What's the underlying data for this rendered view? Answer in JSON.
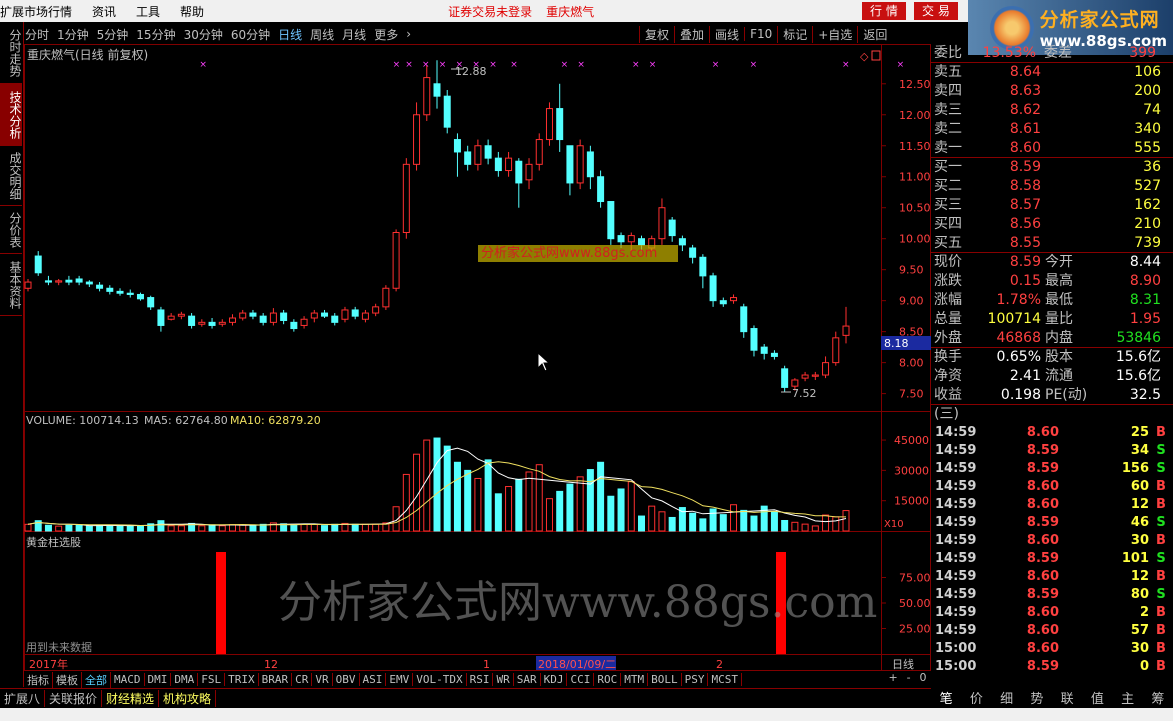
{
  "menubar": {
    "items": [
      "扩展市场行情",
      "资讯",
      "工具",
      "帮助"
    ],
    "status_notice": "证券交易未登录",
    "stock_title": "重庆燃气",
    "right_buttons": [
      "行 情",
      "交 易"
    ],
    "logo_text": "分析家公式网",
    "logo_url": "www.88gs.com"
  },
  "left_tabs": [
    "分时走势",
    "技术分析",
    "成交明细",
    "分价表",
    "基本资料"
  ],
  "period_bar": {
    "items": [
      "分时",
      "1分钟",
      "5分钟",
      "15分钟",
      "30分钟",
      "60分钟",
      "日线",
      "周线",
      "月线",
      "更多"
    ],
    "active": "日线",
    "right_items": [
      "复权",
      "叠加",
      "画线",
      "F10",
      "标记",
      "+自选",
      "返回"
    ]
  },
  "main_chart": {
    "title": "重庆燃气(日线 前复权)",
    "high_label": "12.88",
    "low_label": "7.52",
    "current_price_tag": "8.18",
    "y_ticks": [
      "12.50",
      "12.00",
      "11.50",
      "11.00",
      "10.50",
      "10.00",
      "9.50",
      "9.00",
      "8.50",
      "8.00",
      "7.50"
    ]
  },
  "volume_panel": {
    "header": "VOLUME: 100714.13",
    "ma5": "MA5: 62764.80",
    "ma10": "MA10: 62879.20",
    "y_ticks": [
      "45000",
      "30000",
      "15000"
    ],
    "unit": "X10"
  },
  "gold_panel": {
    "title": "黄金柱选股",
    "note": "用到未来数据",
    "y_ticks": [
      "75.00",
      "50.00",
      "25.00"
    ]
  },
  "time_axis": {
    "labels": [
      "2017年",
      "12",
      "1",
      "2018/01/09/二",
      "2"
    ],
    "period": "日线",
    "controls": [
      "+",
      "-",
      "0"
    ]
  },
  "quote": {
    "weibi_label": "委比",
    "weibi_value": "13.53%",
    "weicha_label": "委差",
    "weicha_value": "399",
    "asks": [
      {
        "label": "卖五",
        "price": "8.64",
        "vol": "106"
      },
      {
        "label": "卖四",
        "price": "8.63",
        "vol": "200"
      },
      {
        "label": "卖三",
        "price": "8.62",
        "vol": "74"
      },
      {
        "label": "卖二",
        "price": "8.61",
        "vol": "340"
      },
      {
        "label": "卖一",
        "price": "8.60",
        "vol": "555"
      }
    ],
    "bids": [
      {
        "label": "买一",
        "price": "8.59",
        "vol": "36"
      },
      {
        "label": "买二",
        "price": "8.58",
        "vol": "527"
      },
      {
        "label": "买三",
        "price": "8.57",
        "vol": "162"
      },
      {
        "label": "买四",
        "price": "8.56",
        "vol": "210"
      },
      {
        "label": "买五",
        "price": "8.55",
        "vol": "739"
      }
    ],
    "stats": [
      {
        "l1": "现价",
        "v1": "8.59",
        "c1": "red",
        "l2": "今开",
        "v2": "8.44",
        "c2": "wht"
      },
      {
        "l1": "涨跌",
        "v1": "0.15",
        "c1": "red",
        "l2": "最高",
        "v2": "8.90",
        "c2": "red"
      },
      {
        "l1": "涨幅",
        "v1": "1.78%",
        "c1": "red",
        "l2": "最低",
        "v2": "8.31",
        "c2": "grn"
      },
      {
        "l1": "总量",
        "v1": "100714",
        "c1": "yel",
        "l2": "量比",
        "v2": "1.95",
        "c2": "red"
      },
      {
        "l1": "外盘",
        "v1": "46868",
        "c1": "red",
        "l2": "内盘",
        "v2": "53846",
        "c2": "grn"
      }
    ],
    "fundamentals": [
      {
        "l1": "换手",
        "v1": "0.65%",
        "l2": "股本",
        "v2": "15.6亿"
      },
      {
        "l1": "净资",
        "v1": "2.41",
        "l2": "流通",
        "v2": "15.6亿"
      },
      {
        "l1": "收益(三)",
        "v1": "0.198",
        "l2": "PE(动)",
        "v2": "32.5"
      }
    ]
  },
  "ticks": [
    {
      "t": "14:59",
      "p": "8.60",
      "v": "25",
      "s": "B"
    },
    {
      "t": "14:59",
      "p": "8.59",
      "v": "34",
      "s": "S"
    },
    {
      "t": "14:59",
      "p": "8.59",
      "v": "156",
      "s": "S"
    },
    {
      "t": "14:59",
      "p": "8.60",
      "v": "60",
      "s": "B"
    },
    {
      "t": "14:59",
      "p": "8.60",
      "v": "12",
      "s": "B"
    },
    {
      "t": "14:59",
      "p": "8.59",
      "v": "46",
      "s": "S"
    },
    {
      "t": "14:59",
      "p": "8.60",
      "v": "30",
      "s": "B"
    },
    {
      "t": "14:59",
      "p": "8.59",
      "v": "101",
      "s": "S"
    },
    {
      "t": "14:59",
      "p": "8.60",
      "v": "12",
      "s": "B"
    },
    {
      "t": "14:59",
      "p": "8.59",
      "v": "80",
      "s": "S"
    },
    {
      "t": "14:59",
      "p": "8.60",
      "v": "2",
      "s": "B"
    },
    {
      "t": "14:59",
      "p": "8.60",
      "v": "57",
      "s": "B"
    },
    {
      "t": "15:00",
      "p": "8.60",
      "v": "30",
      "s": "B"
    },
    {
      "t": "15:00",
      "p": "8.59",
      "v": "0",
      "s": "B"
    }
  ],
  "bottom_tabs": [
    "笔",
    "价",
    "细",
    "势",
    "联",
    "值",
    "主",
    "筹"
  ],
  "indicator_tabs": [
    "指标",
    "模板",
    "全部",
    "MACD",
    "DMI",
    "DMA",
    "FSL",
    "TRIX",
    "BRAR",
    "CR",
    "VR",
    "OBV",
    "ASI",
    "EMV",
    "VOL-TDX",
    "RSI",
    "WR",
    "SAR",
    "KDJ",
    "CCI",
    "ROC",
    "MTM",
    "BOLL",
    "PSY",
    "MCST"
  ],
  "indicator_active": "全部",
  "status_bar": [
    "扩展八",
    "关联报价",
    "财经精选",
    "机构攻略"
  ],
  "watermark_main": "分析家公式网www.88gs.com",
  "watermark_band": "分析家公式网www.88gs.com",
  "colors": {
    "up": "#ff3030",
    "down": "#54ffff",
    "border": "#800000"
  },
  "chart_data": {
    "type": "candlestick",
    "title": "重庆燃气(日线 前复权)",
    "ylim": [
      7.3,
      12.9
    ],
    "candles": [
      [
        9.2,
        9.3,
        9.15,
        9.35
      ],
      [
        9.72,
        9.45,
        9.4,
        9.8
      ],
      [
        9.32,
        9.3,
        9.25,
        9.4
      ],
      [
        9.3,
        9.32,
        9.25,
        9.35
      ],
      [
        9.33,
        9.3,
        9.25,
        9.4
      ],
      [
        9.35,
        9.3,
        9.25,
        9.4
      ],
      [
        9.3,
        9.27,
        9.22,
        9.33
      ],
      [
        9.25,
        9.2,
        9.15,
        9.3
      ],
      [
        9.2,
        9.15,
        9.1,
        9.25
      ],
      [
        9.15,
        9.12,
        9.08,
        9.2
      ],
      [
        9.12,
        9.1,
        9.05,
        9.18
      ],
      [
        9.1,
        9.03,
        9.0,
        9.13
      ],
      [
        9.05,
        8.9,
        8.85,
        9.08
      ],
      [
        8.85,
        8.6,
        8.5,
        8.9
      ],
      [
        8.7,
        8.75,
        8.68,
        8.8
      ],
      [
        8.75,
        8.78,
        8.7,
        8.82
      ],
      [
        8.75,
        8.6,
        8.55,
        8.8
      ],
      [
        8.62,
        8.65,
        8.58,
        8.7
      ],
      [
        8.65,
        8.6,
        8.55,
        8.72
      ],
      [
        8.62,
        8.65,
        8.58,
        8.7
      ],
      [
        8.65,
        8.72,
        8.6,
        8.78
      ],
      [
        8.72,
        8.8,
        8.68,
        8.85
      ],
      [
        8.8,
        8.75,
        8.7,
        8.85
      ],
      [
        8.75,
        8.65,
        8.6,
        8.8
      ],
      [
        8.65,
        8.8,
        8.6,
        8.88
      ],
      [
        8.8,
        8.68,
        8.62,
        8.85
      ],
      [
        8.65,
        8.55,
        8.5,
        8.7
      ],
      [
        8.6,
        8.7,
        8.55,
        8.75
      ],
      [
        8.72,
        8.8,
        8.65,
        8.85
      ],
      [
        8.8,
        8.75,
        8.72,
        8.85
      ],
      [
        8.75,
        8.65,
        8.6,
        8.8
      ],
      [
        8.7,
        8.85,
        8.65,
        8.9
      ],
      [
        8.85,
        8.75,
        8.7,
        8.9
      ],
      [
        8.7,
        8.8,
        8.65,
        8.85
      ],
      [
        8.8,
        8.9,
        8.75,
        8.95
      ],
      [
        8.9,
        9.2,
        8.85,
        9.25
      ],
      [
        9.2,
        10.1,
        9.15,
        10.15
      ],
      [
        10.1,
        11.2,
        10.0,
        11.3
      ],
      [
        11.2,
        12.0,
        11.1,
        12.2
      ],
      [
        12.0,
        12.6,
        11.9,
        12.8
      ],
      [
        12.5,
        12.3,
        12.1,
        12.88
      ],
      [
        12.3,
        11.8,
        11.7,
        12.4
      ],
      [
        11.6,
        11.4,
        11.0,
        11.7
      ],
      [
        11.4,
        11.2,
        11.1,
        11.5
      ],
      [
        11.2,
        11.5,
        11.1,
        11.6
      ],
      [
        11.5,
        11.3,
        11.2,
        11.6
      ],
      [
        11.3,
        11.1,
        11.0,
        11.4
      ],
      [
        11.1,
        11.3,
        11.0,
        11.4
      ],
      [
        11.25,
        10.9,
        10.5,
        11.3
      ],
      [
        10.95,
        11.2,
        10.8,
        11.3
      ],
      [
        11.2,
        11.6,
        11.1,
        11.7
      ],
      [
        11.6,
        12.1,
        11.5,
        12.2
      ],
      [
        12.1,
        11.6,
        11.4,
        12.5
      ],
      [
        11.5,
        10.9,
        10.7,
        11.5
      ],
      [
        10.9,
        11.5,
        10.8,
        11.6
      ],
      [
        11.4,
        11.0,
        10.8,
        11.5
      ],
      [
        11.0,
        10.6,
        10.5,
        11.1
      ],
      [
        10.6,
        10.0,
        9.9,
        10.6
      ],
      [
        10.05,
        9.95,
        9.85,
        10.1
      ],
      [
        9.95,
        10.05,
        9.8,
        10.1
      ],
      [
        10.0,
        9.9,
        9.8,
        10.05
      ],
      [
        9.85,
        10.0,
        9.8,
        10.05
      ],
      [
        10.0,
        10.5,
        9.9,
        10.65
      ],
      [
        10.3,
        10.05,
        9.95,
        10.35
      ],
      [
        10.0,
        9.9,
        9.8,
        10.05
      ],
      [
        9.85,
        9.7,
        9.6,
        9.9
      ],
      [
        9.7,
        9.4,
        9.2,
        9.75
      ],
      [
        9.4,
        9.0,
        8.9,
        9.45
      ],
      [
        9.0,
        8.95,
        8.9,
        9.05
      ],
      [
        9.0,
        9.05,
        8.95,
        9.1
      ],
      [
        8.9,
        8.5,
        8.4,
        8.95
      ],
      [
        8.55,
        8.2,
        8.1,
        8.6
      ],
      [
        8.25,
        8.15,
        8.05,
        8.3
      ],
      [
        8.15,
        8.1,
        8.05,
        8.2
      ],
      [
        7.9,
        7.6,
        7.52,
        7.95
      ],
      [
        7.62,
        7.72,
        7.55,
        7.75
      ],
      [
        7.75,
        7.8,
        7.7,
        7.85
      ],
      [
        7.78,
        7.8,
        7.72,
        7.85
      ],
      [
        7.8,
        8.0,
        7.75,
        8.1
      ],
      [
        8.0,
        8.4,
        7.95,
        8.5
      ],
      [
        8.44,
        8.59,
        8.31,
        8.9
      ]
    ],
    "volume_ma5": "62764.80",
    "volume_ma10": "62879.20"
  }
}
